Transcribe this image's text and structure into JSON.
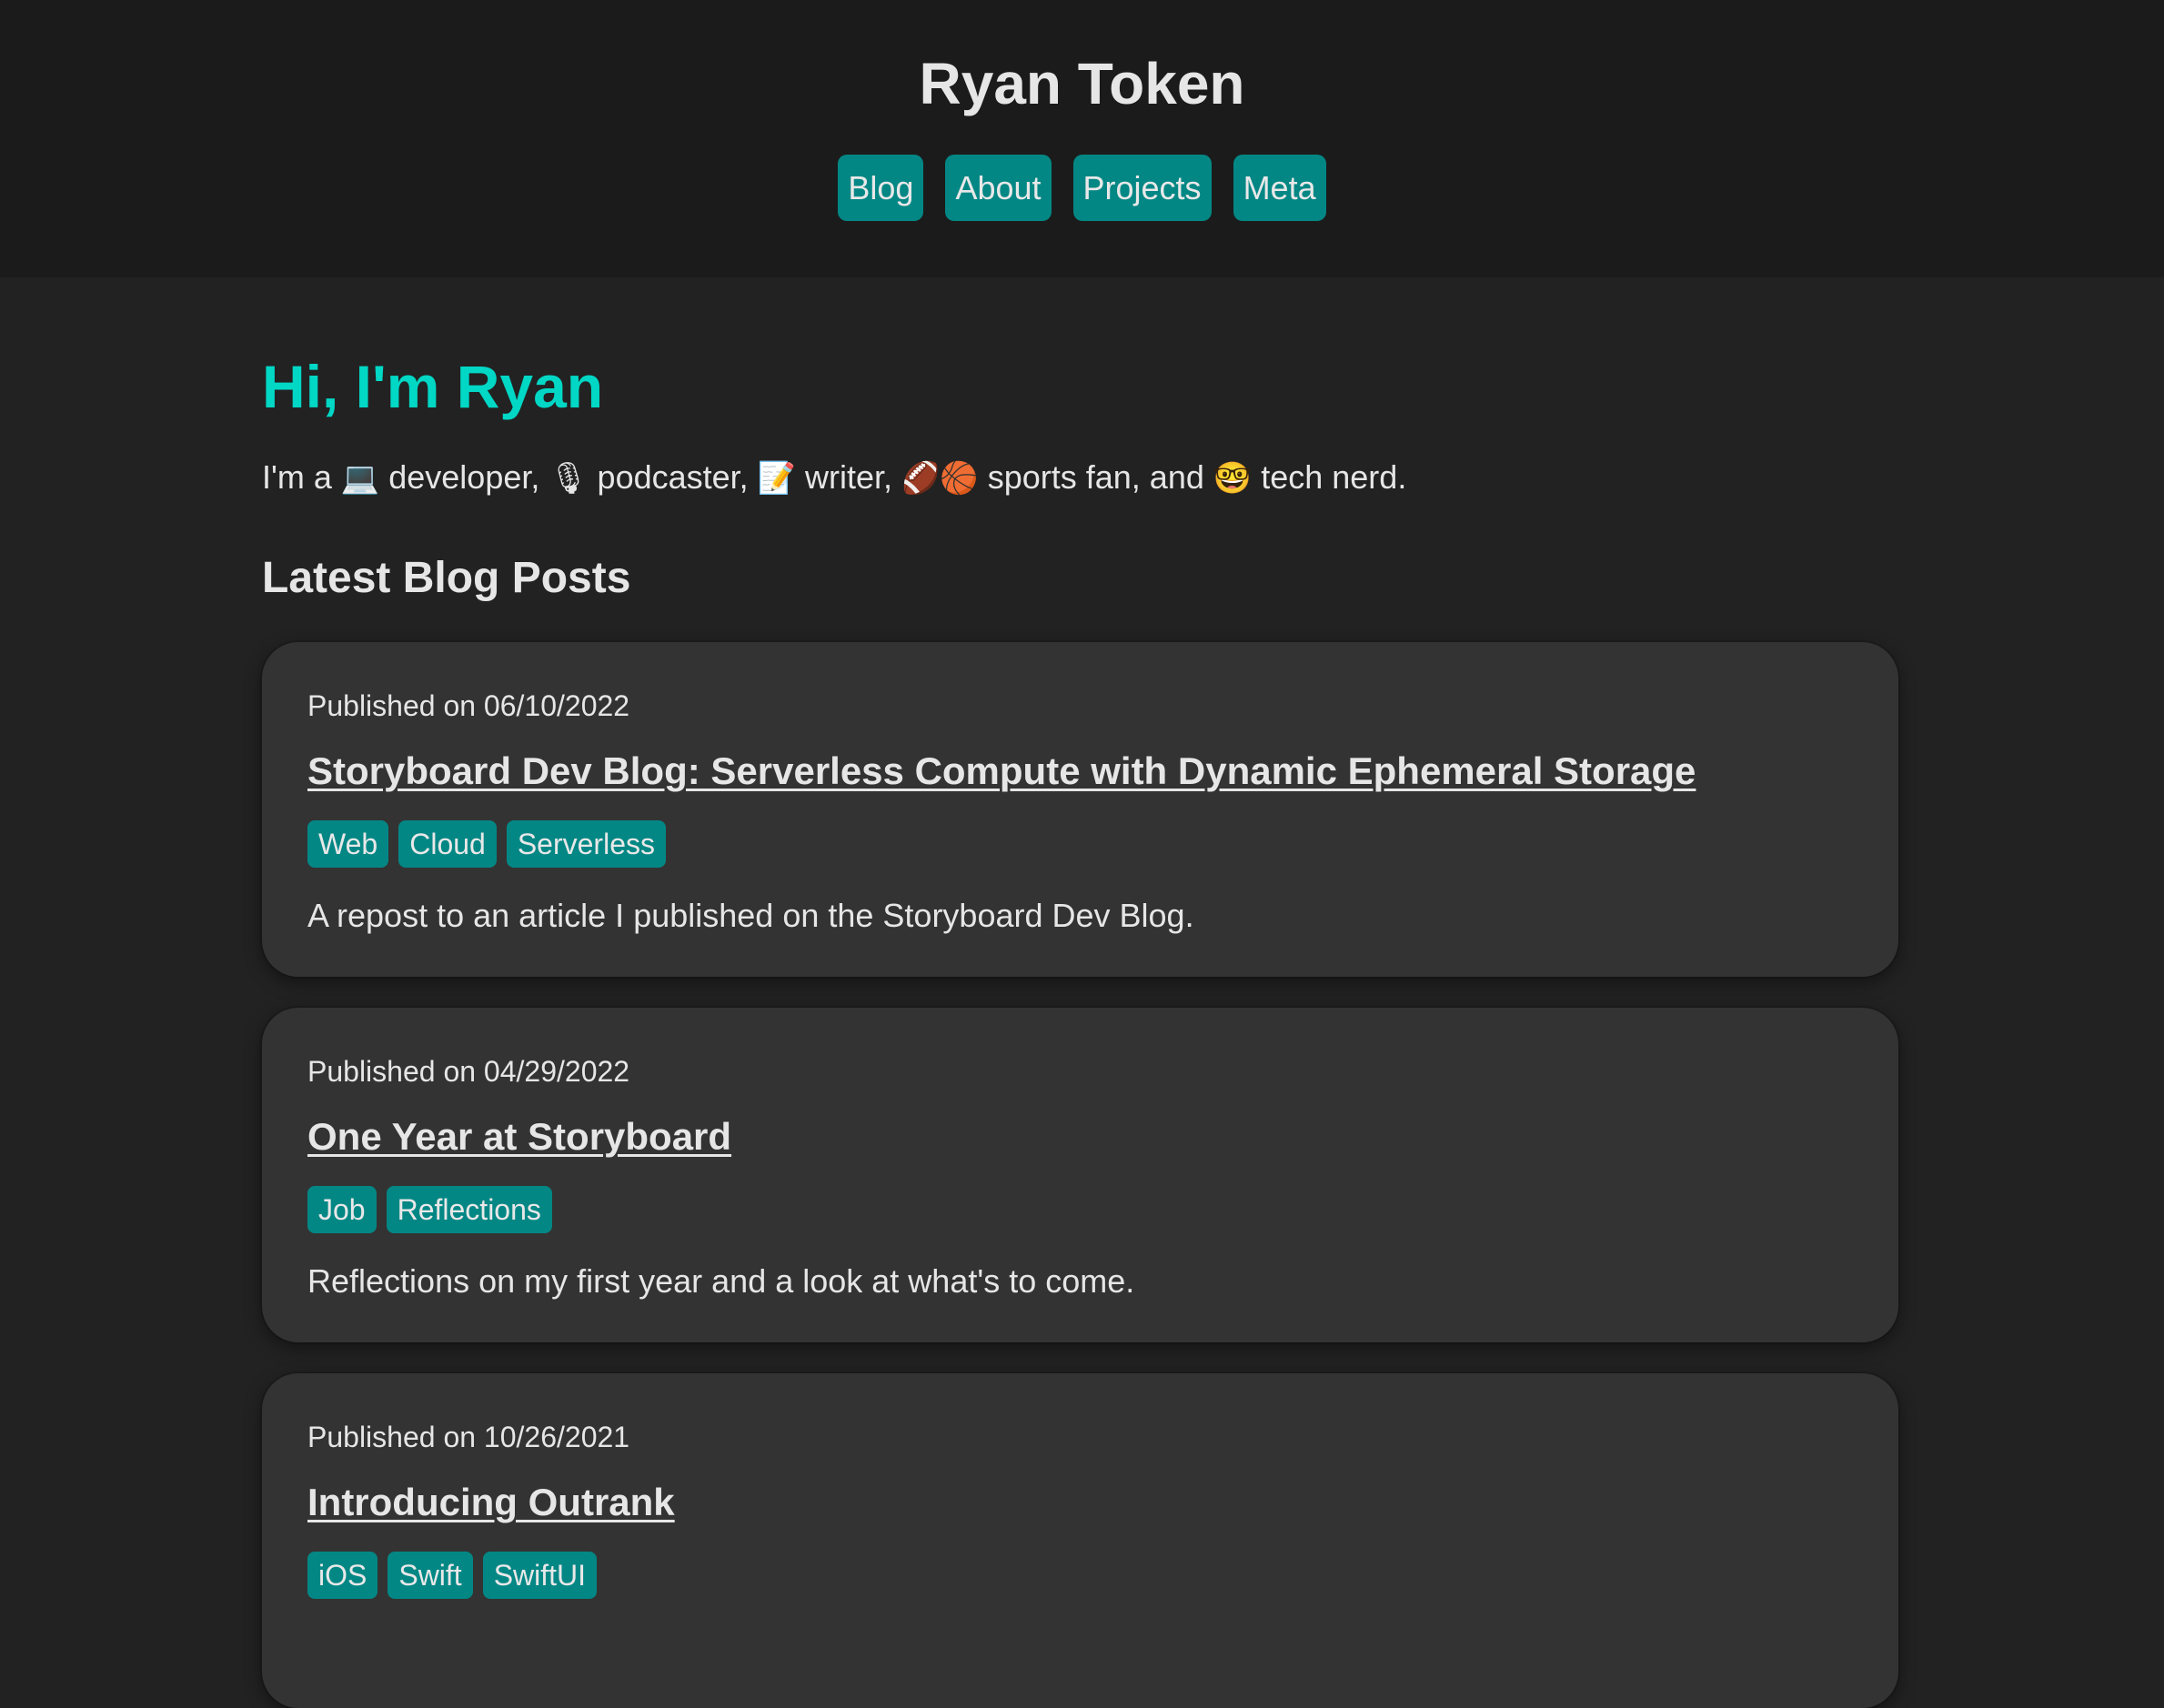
{
  "header": {
    "title": "Ryan Token",
    "nav": [
      {
        "label": "Blog"
      },
      {
        "label": "About"
      },
      {
        "label": "Projects"
      },
      {
        "label": "Meta"
      }
    ]
  },
  "hero": {
    "title": "Hi, I'm Ryan",
    "intro": [
      {
        "text": "I'm a "
      },
      {
        "emoji": "💻",
        "icon": "laptop-icon"
      },
      {
        "text": " developer, "
      },
      {
        "emoji": "🎙",
        "icon": "microphone-icon"
      },
      {
        "text": " podcaster, "
      },
      {
        "emoji": "📝",
        "icon": "memo-icon"
      },
      {
        "text": " writer, "
      },
      {
        "emoji": "🏈",
        "icon": "football-icon"
      },
      {
        "emoji": "🏀",
        "icon": "basketball-icon"
      },
      {
        "text": " sports fan, and "
      },
      {
        "emoji": "🤓",
        "icon": "nerd-face-icon"
      },
      {
        "text": " tech nerd."
      }
    ]
  },
  "blog": {
    "section_title": "Latest Blog Posts",
    "posts": [
      {
        "date": "Published on 06/10/2022",
        "title": "Storyboard Dev Blog: Serverless Compute with Dynamic Ephemeral Storage",
        "tags": [
          "Web",
          "Cloud",
          "Serverless"
        ],
        "summary": "A repost to an article I published on the Storyboard Dev Blog."
      },
      {
        "date": "Published on 04/29/2022",
        "title": "One Year at Storyboard",
        "tags": [
          "Job",
          "Reflections"
        ],
        "summary": "Reflections on my first year and a look at what's to come."
      },
      {
        "date": "Published on 10/26/2021",
        "title": "Introducing Outrank",
        "tags": [
          "iOS",
          "Swift",
          "SwiftUI"
        ],
        "summary": ""
      }
    ]
  },
  "colors": {
    "accent": "#038785",
    "hero_title": "#00d7c5",
    "header_bg": "#1b1b1b",
    "page_bg": "#222222",
    "card_bg": "#333333",
    "text": "#e6e6e6"
  }
}
